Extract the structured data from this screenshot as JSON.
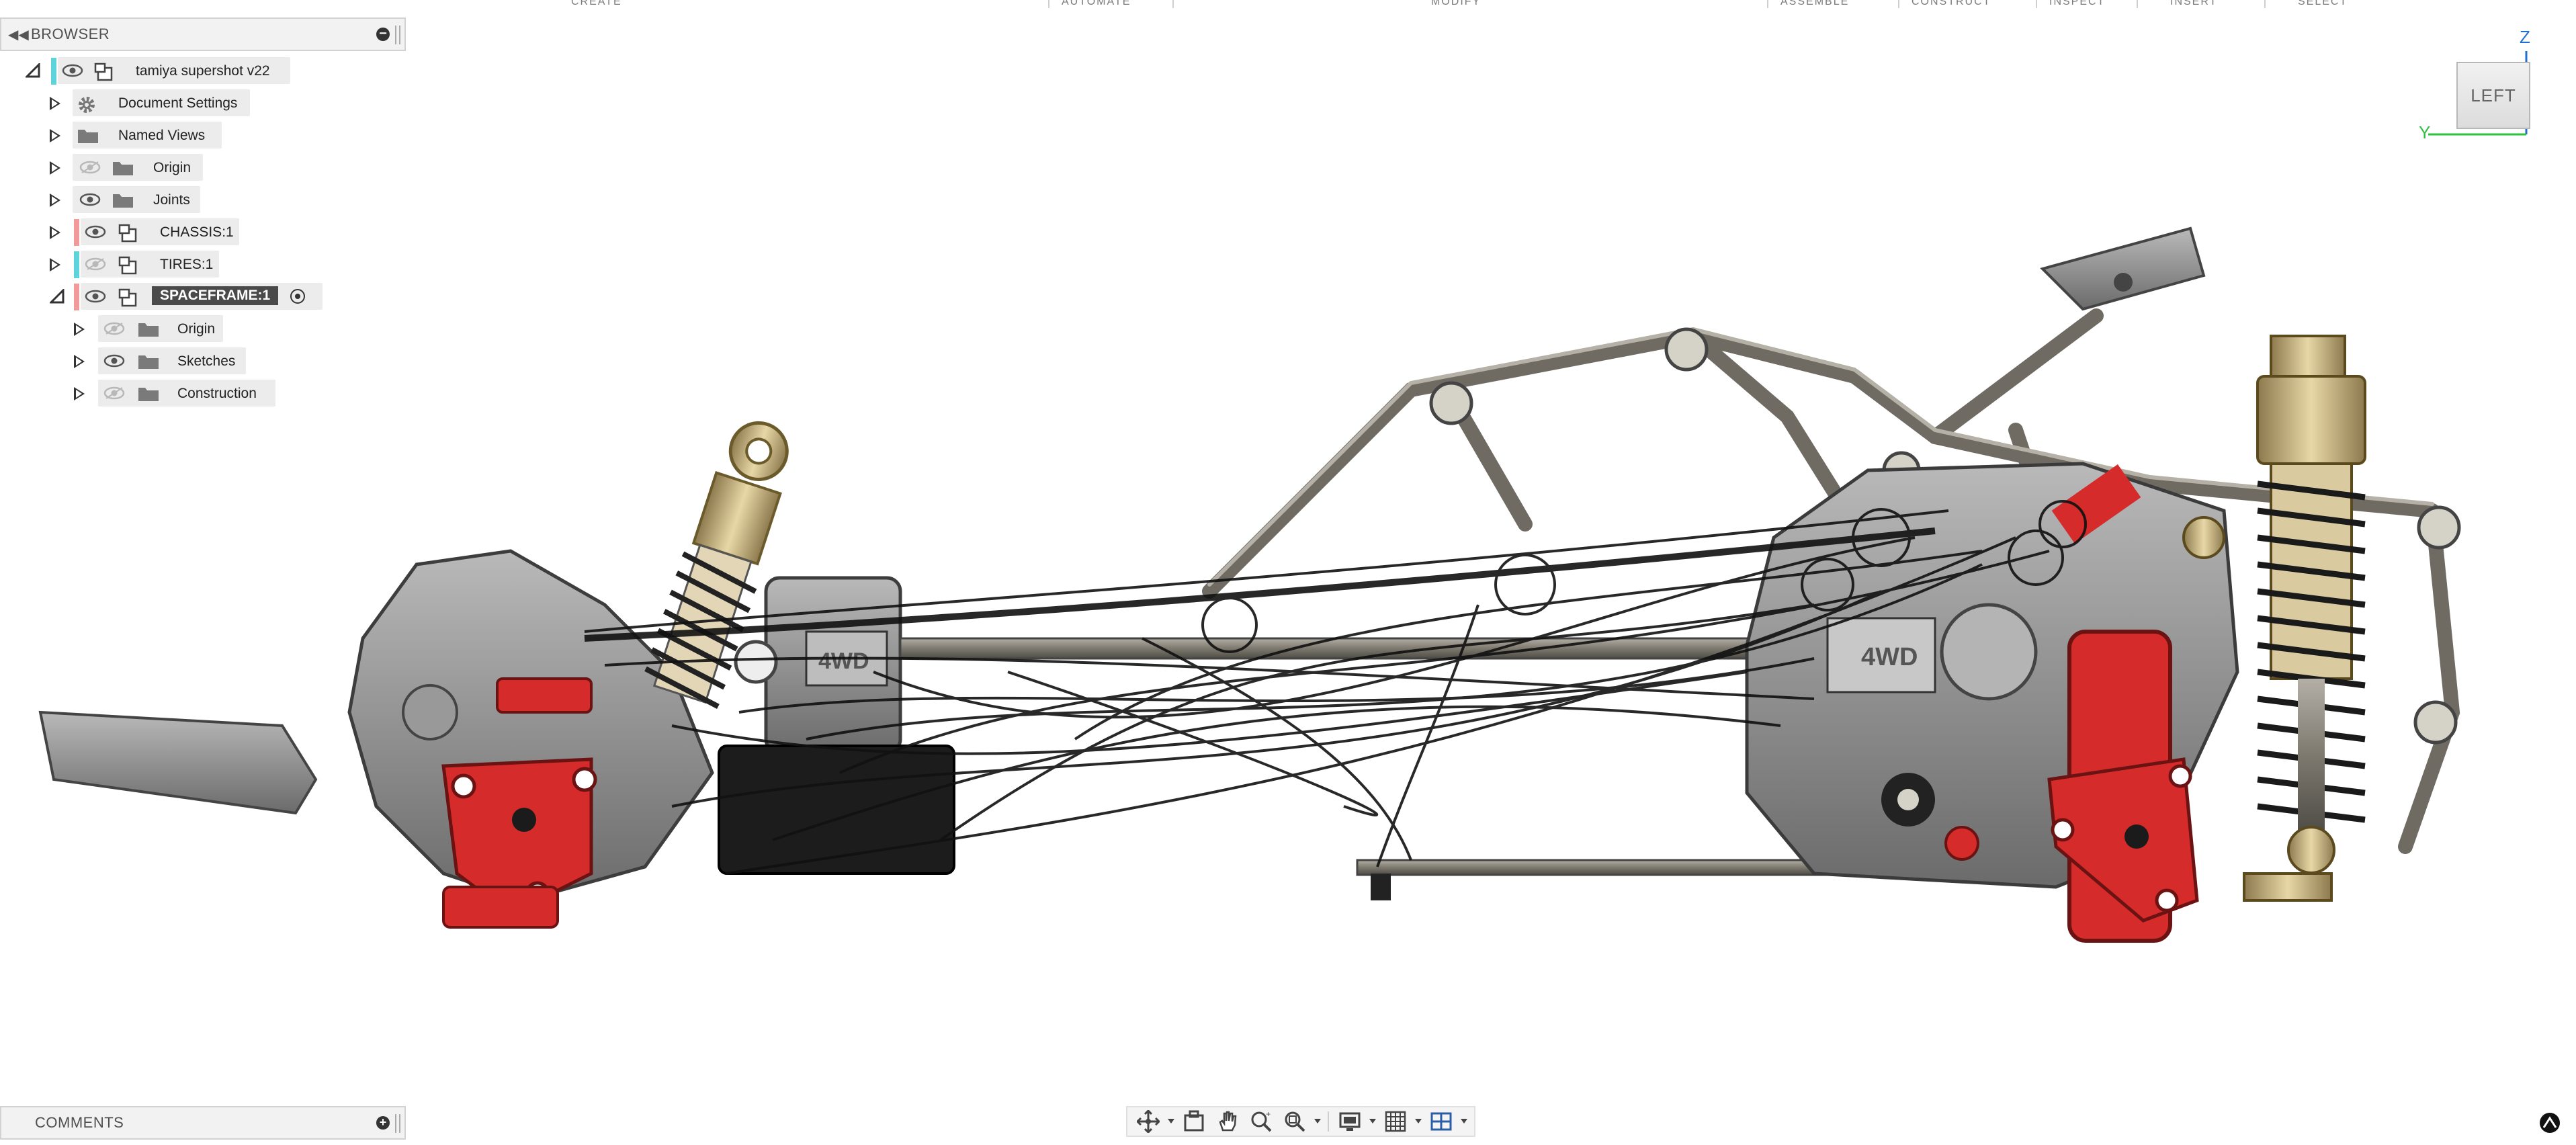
{
  "top_toolbar": {
    "labels": [
      "CREATE",
      "AUTOMATE",
      "MODIFY",
      "ASSEMBLE",
      "CONSTRUCT",
      "INSPECT",
      "INSERT",
      "SELECT"
    ]
  },
  "browser": {
    "title": "BROWSER",
    "root": {
      "label": "tamiya supershot v22",
      "color": "#5fd3dc"
    },
    "items": [
      {
        "label": "Document Settings",
        "icon": "gear-icon"
      },
      {
        "label": "Named Views",
        "icon": "folder-icon"
      },
      {
        "label": "Origin",
        "icon": "folder-icon",
        "visibility": "hidden"
      },
      {
        "label": "Joints",
        "icon": "folder-icon",
        "visibility": "visible"
      },
      {
        "label": "CHASSIS:1",
        "icon": "component-icon",
        "color": "#f29a9a"
      },
      {
        "label": "TIRES:1",
        "icon": "component-icon",
        "color": "#5fd3dc",
        "visibility": "hidden"
      },
      {
        "label": "SPACEFRAME:1",
        "icon": "component-icon",
        "color": "#f29a9a",
        "active": true
      }
    ],
    "children": [
      {
        "label": "Origin",
        "icon": "folder-icon",
        "visibility": "hidden"
      },
      {
        "label": "Sketches",
        "icon": "folder-icon",
        "visibility": "visible"
      },
      {
        "label": "Construction",
        "icon": "folder-icon",
        "visibility": "hidden"
      }
    ]
  },
  "comments": {
    "title": "COMMENTS"
  },
  "viewcube": {
    "face": "LEFT",
    "axis_up": "Z",
    "axis_side": "Y",
    "axis_up_color": "#1f6fd1",
    "axis_side_color": "#2fbf3f"
  },
  "bottom_toolbar": {
    "buttons": [
      "orbit-icon",
      "look-at-icon",
      "pan-icon",
      "zoom-icon",
      "fit-icon",
      "display-settings-icon",
      "grid-icon",
      "viewports-icon"
    ]
  },
  "model": {
    "name": "tamiya supershot v22",
    "badge_front": "4WD",
    "badge_rear": "4WD",
    "accent": "#d62b2b",
    "frame": "#7c786f"
  }
}
